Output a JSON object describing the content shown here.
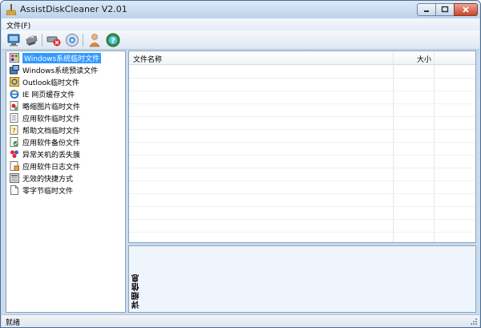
{
  "window": {
    "title": "AssistDiskCleaner V2.01"
  },
  "menu": {
    "file": "文件(F)"
  },
  "toolbar": {
    "buttons": [
      "monitor-icon",
      "printer-icon",
      "delete-drive-icon",
      "disk-scan-icon",
      "user-icon",
      "help-icon"
    ]
  },
  "tree": {
    "items": [
      {
        "label": "Windows系统临时文件",
        "icon": "windows-temp-icon"
      },
      {
        "label": "Windows系统预读文件",
        "icon": "windows-prefetch-icon"
      },
      {
        "label": "Outlook临时文件",
        "icon": "outlook-icon"
      },
      {
        "label": "IE 网页缓存文件",
        "icon": "ie-icon"
      },
      {
        "label": "略缩图片临时文件",
        "icon": "thumbnail-icon"
      },
      {
        "label": "应用软件临时文件",
        "icon": "app-temp-icon"
      },
      {
        "label": "帮助文档临时文件",
        "icon": "help-doc-icon"
      },
      {
        "label": "应用软件备份文件",
        "icon": "backup-icon"
      },
      {
        "label": "异常关机的丢失簇",
        "icon": "lost-cluster-icon"
      },
      {
        "label": "应用软件日志文件",
        "icon": "log-icon"
      },
      {
        "label": "无效的快捷方式",
        "icon": "shortcut-icon"
      },
      {
        "label": "零字节临时文件",
        "icon": "zero-byte-icon"
      }
    ]
  },
  "list": {
    "col_name": "文件名称",
    "col_size": "大小"
  },
  "detail": {
    "label": "详细信息"
  },
  "status": {
    "text": "就绪"
  },
  "colors": {
    "selection": "#3399ff",
    "frame": "#c9dcef",
    "close": "#c7482b"
  }
}
